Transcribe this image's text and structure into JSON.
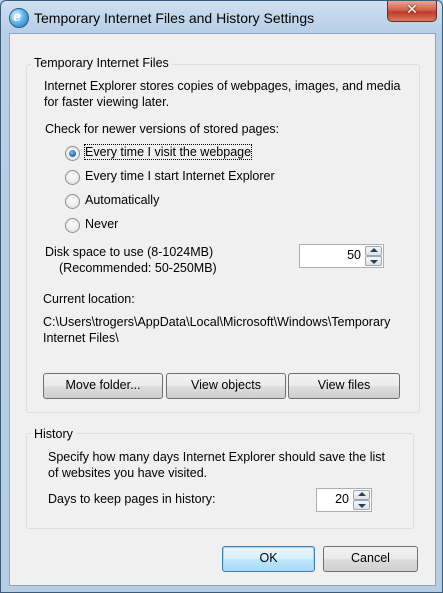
{
  "window": {
    "title": "Temporary Internet Files and History Settings",
    "close_glyph": "✕"
  },
  "tif": {
    "legend": "Temporary Internet Files",
    "description_line1": "Internet Explorer stores copies of webpages, images, and media",
    "description_line2": "for faster viewing later.",
    "check_label": "Check for newer versions of stored pages:",
    "options": [
      {
        "label": "Every time I visit the webpage",
        "checked": true
      },
      {
        "label": "Every time I start Internet Explorer",
        "checked": false
      },
      {
        "label": "Automatically",
        "checked": false
      },
      {
        "label": "Never",
        "checked": false
      }
    ],
    "disk_label": "Disk space to use (8-1024MB)",
    "disk_recommended": "(Recommended: 50-250MB)",
    "disk_value": "50",
    "location_label": "Current location:",
    "location_line1": "C:\\Users\\trogers\\AppData\\Local\\Microsoft\\Windows\\Temporary",
    "location_line2": "Internet Files\\",
    "buttons": {
      "move_folder": "Move folder...",
      "view_objects": "View objects",
      "view_files": "View files"
    }
  },
  "history": {
    "legend": "History",
    "description_line1": "Specify how many days Internet Explorer should save the list",
    "description_line2": "of websites you have visited.",
    "days_label": "Days to keep pages in history:",
    "days_value": "20"
  },
  "footer": {
    "ok": "OK",
    "cancel": "Cancel"
  },
  "colors": {
    "titlebar": "#cfe0f1",
    "close_button": "#c0392b",
    "dialog_background": "#f0f0f0",
    "default_button": "#bee6fd"
  }
}
